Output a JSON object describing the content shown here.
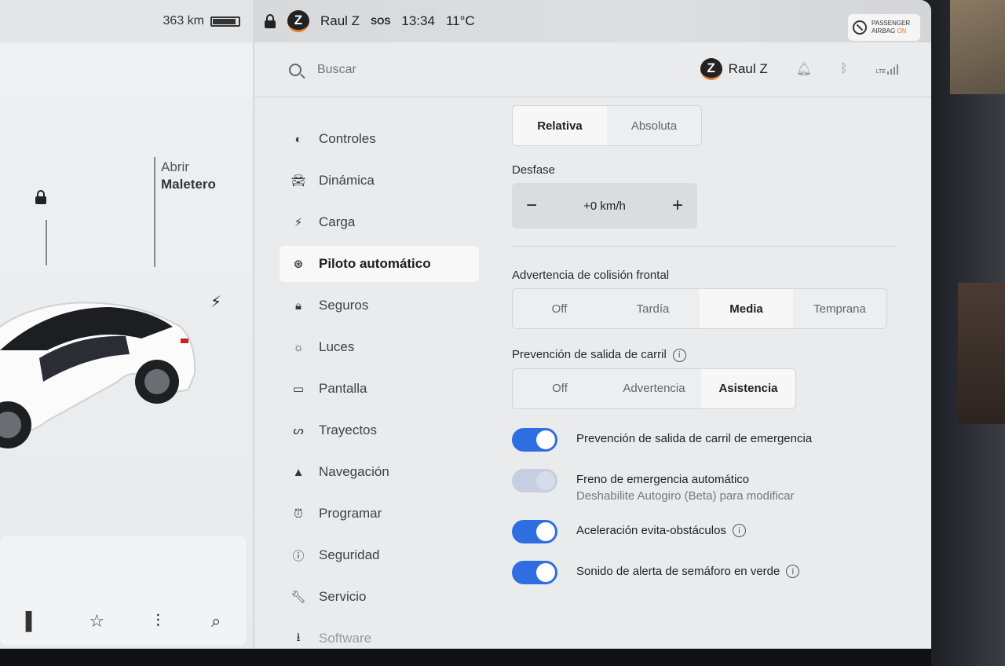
{
  "status": {
    "range": "363 km",
    "driver": "Raul Z",
    "profile_initial": "Z",
    "sos": "SOS",
    "time": "13:34",
    "temperature": "11°C",
    "airbag_line1": "PASSENGER",
    "airbag_line2": "AIRBAG",
    "airbag_state": "ON"
  },
  "car": {
    "trunk_line1": "Abrir",
    "trunk_line2": "Maletero"
  },
  "search": {
    "placeholder": "Buscar"
  },
  "header": {
    "profile_name": "Raul Z",
    "profile_initial": "Z",
    "network": "LTE"
  },
  "nav": {
    "items": [
      {
        "label": "Controles",
        "icon": "toggle-icon"
      },
      {
        "label": "Dinámica",
        "icon": "car-icon"
      },
      {
        "label": "Carga",
        "icon": "bolt-icon"
      },
      {
        "label": "Piloto automático",
        "icon": "steering-wheel-icon"
      },
      {
        "label": "Seguros",
        "icon": "lock-icon"
      },
      {
        "label": "Luces",
        "icon": "sun-icon"
      },
      {
        "label": "Pantalla",
        "icon": "display-icon"
      },
      {
        "label": "Trayectos",
        "icon": "trips-icon"
      },
      {
        "label": "Navegación",
        "icon": "navigation-icon"
      },
      {
        "label": "Programar",
        "icon": "alarm-icon"
      },
      {
        "label": "Seguridad",
        "icon": "alert-icon"
      },
      {
        "label": "Servicio",
        "icon": "wrench-icon"
      },
      {
        "label": "Software",
        "icon": "download-icon"
      }
    ],
    "active": "Piloto automático"
  },
  "speed_mode": {
    "options": [
      "Relativa",
      "Absoluta"
    ],
    "selected": "Relativa"
  },
  "offset": {
    "label": "Desfase",
    "value": "+0 km/h",
    "minus": "−",
    "plus": "+"
  },
  "collision": {
    "label": "Advertencia de colisión frontal",
    "options": [
      "Off",
      "Tardía",
      "Media",
      "Temprana"
    ],
    "selected": "Media"
  },
  "lane_departure": {
    "label": "Prevención de salida de carril",
    "options": [
      "Off",
      "Advertencia",
      "Asistencia"
    ],
    "selected": "Asistencia"
  },
  "toggles": [
    {
      "label": "Prevención de salida de carril de emergencia",
      "on": true,
      "enabled": true
    },
    {
      "label": "Freno de emergencia automático",
      "sub": "Deshabilite Autogiro (Beta) para modificar",
      "on": true,
      "enabled": false
    },
    {
      "label": "Aceleración evita-obstáculos",
      "on": true,
      "enabled": true,
      "info": true
    },
    {
      "label": "Sonido de alerta de semáforo en verde",
      "on": true,
      "enabled": true,
      "info": true
    }
  ],
  "colors": {
    "accent": "#2f6ee0",
    "active_bg": "#f8f8f9"
  }
}
